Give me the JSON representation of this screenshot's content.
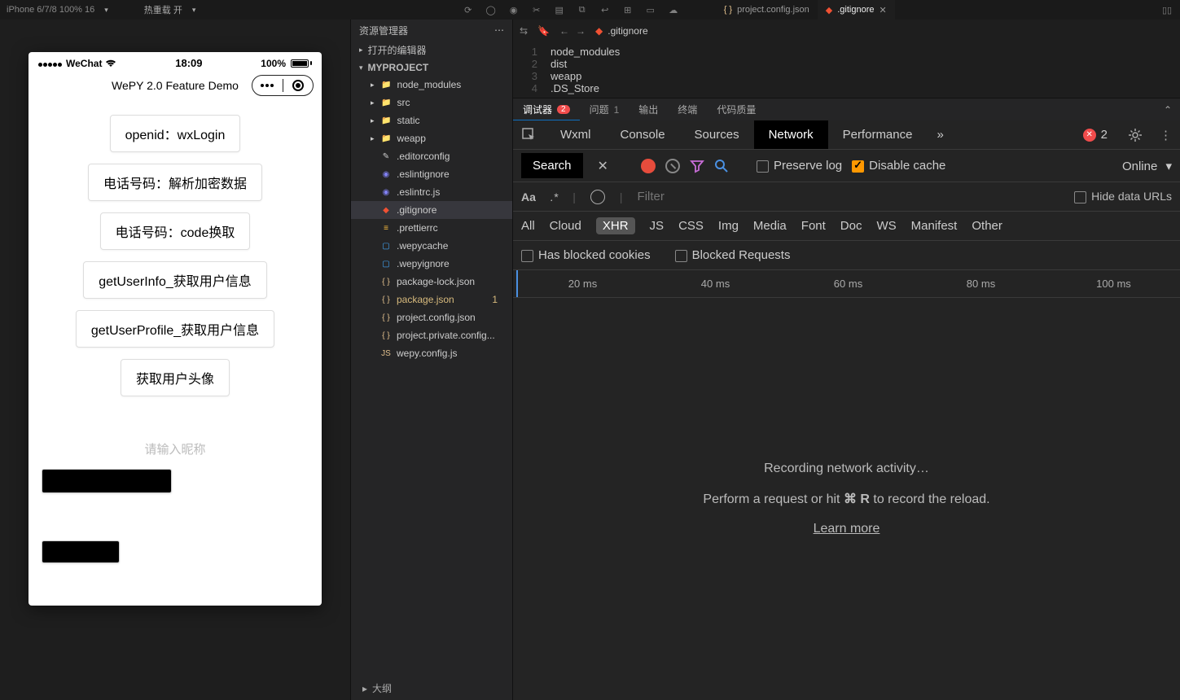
{
  "toolbar": {
    "device": "iPhone 6/7/8 100% 16",
    "hot_reload": "热重载 开",
    "editor_tabs": [
      {
        "label": "project.config.json",
        "active": false
      },
      {
        "label": ".gitignore",
        "active": true
      }
    ]
  },
  "simulator": {
    "carrier": "WeChat",
    "time": "18:09",
    "battery_pct": "100%",
    "app_title": "WePY 2.0 Feature Demo",
    "buttons": [
      "openid：wxLogin",
      "电话号码：解析加密数据",
      "电话号码：code换取",
      "getUserInfo_获取用户信息",
      "getUserProfile_获取用户信息",
      "获取用户头像"
    ],
    "nickname_placeholder": "请输入昵称"
  },
  "explorer": {
    "title": "资源管理器",
    "open_editors": "打开的编辑器",
    "project": "MYPROJECT",
    "tree": [
      {
        "label": "node_modules",
        "kind": "folder-green",
        "expandable": true
      },
      {
        "label": "src",
        "kind": "folder-blue",
        "expandable": true
      },
      {
        "label": "static",
        "kind": "folder",
        "expandable": true
      },
      {
        "label": "weapp",
        "kind": "folder-blue",
        "expandable": true
      },
      {
        "label": ".editorconfig",
        "kind": "edit"
      },
      {
        "label": ".eslintignore",
        "kind": "eslint"
      },
      {
        "label": ".eslintrc.js",
        "kind": "eslint"
      },
      {
        "label": ".gitignore",
        "kind": "git",
        "selected": true
      },
      {
        "label": ".prettierrc",
        "kind": "prettier"
      },
      {
        "label": ".wepycache",
        "kind": "blue"
      },
      {
        "label": ".wepyignore",
        "kind": "blue"
      },
      {
        "label": "package-lock.json",
        "kind": "json"
      },
      {
        "label": "package.json",
        "kind": "json",
        "modified": true,
        "badge": "1"
      },
      {
        "label": "project.config.json",
        "kind": "json"
      },
      {
        "label": "project.private.config...",
        "kind": "json"
      },
      {
        "label": "wepy.config.js",
        "kind": "js"
      }
    ],
    "outline": "大纲"
  },
  "editor": {
    "breadcrumb": ".gitignore",
    "lines": [
      "node_modules",
      "dist",
      "weapp",
      ".DS_Store"
    ]
  },
  "panel_tabs": {
    "items": [
      {
        "label": "调试器",
        "active": true,
        "badge_red": "2"
      },
      {
        "label": "问题",
        "badge_gray": "1"
      },
      {
        "label": "输出"
      },
      {
        "label": "终端"
      },
      {
        "label": "代码质量"
      }
    ]
  },
  "devtools": {
    "tabs": [
      "Wxml",
      "Console",
      "Sources",
      "Network",
      "Performance"
    ],
    "active_tab": "Network",
    "error_count": "2",
    "search_label": "Search",
    "preserve_log": "Preserve log",
    "disable_cache": "Disable cache",
    "throttle": "Online",
    "aa": "Aa",
    "regex": ".*",
    "filter_placeholder": "Filter",
    "hide_data_urls": "Hide data URLs",
    "types": [
      "All",
      "Cloud",
      "XHR",
      "JS",
      "CSS",
      "Img",
      "Media",
      "Font",
      "Doc",
      "WS",
      "Manifest",
      "Other"
    ],
    "active_type": "XHR",
    "blocked_cookies": "Has blocked cookies",
    "blocked_requests": "Blocked Requests",
    "timeline_ticks": [
      "20 ms",
      "40 ms",
      "60 ms",
      "80 ms",
      "100 ms"
    ],
    "empty": {
      "line1": "Recording network activity…",
      "line2a": "Perform a request or hit ",
      "line2b": "⌘ R",
      "line2c": " to record the reload.",
      "learn_more": "Learn more"
    }
  }
}
